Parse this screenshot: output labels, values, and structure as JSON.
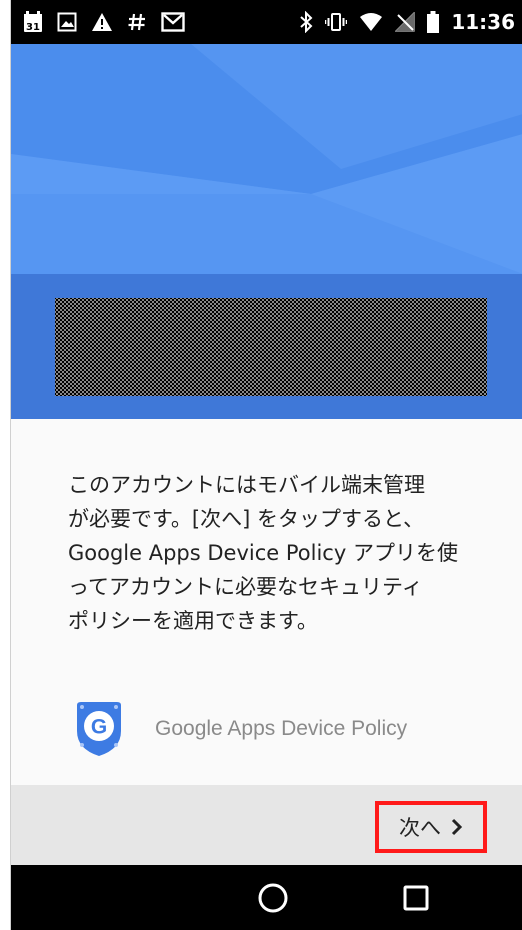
{
  "status_bar": {
    "time": "11:36",
    "calendar_day": "31",
    "left_icons": [
      "calendar-icon",
      "image-icon",
      "warning-icon",
      "hash-icon",
      "gmail-icon"
    ],
    "right_icons": [
      "bluetooth-icon",
      "vibrate-icon",
      "wifi-icon",
      "no-signal-icon",
      "battery-icon"
    ]
  },
  "hero": {
    "account_placeholder": "redacted-account-box"
  },
  "message": {
    "lines": [
      "このアカウントにはモバイル端末管理",
      "が必要です。[次へ] をタップすると、",
      "Google Apps Device Policy アプリを使",
      "ってアカウントに必要なセキュリティ",
      "ポリシーを適用できます。"
    ]
  },
  "app": {
    "name": "Google Apps Device Policy",
    "icon_letter": "G"
  },
  "footer": {
    "next_label": "次へ",
    "highlight_color": "#ff1a1a"
  },
  "colors": {
    "hero_blue": "#5a99f3",
    "band_blue": "#3f78d8",
    "footer_gray": "#e6e6e6"
  }
}
